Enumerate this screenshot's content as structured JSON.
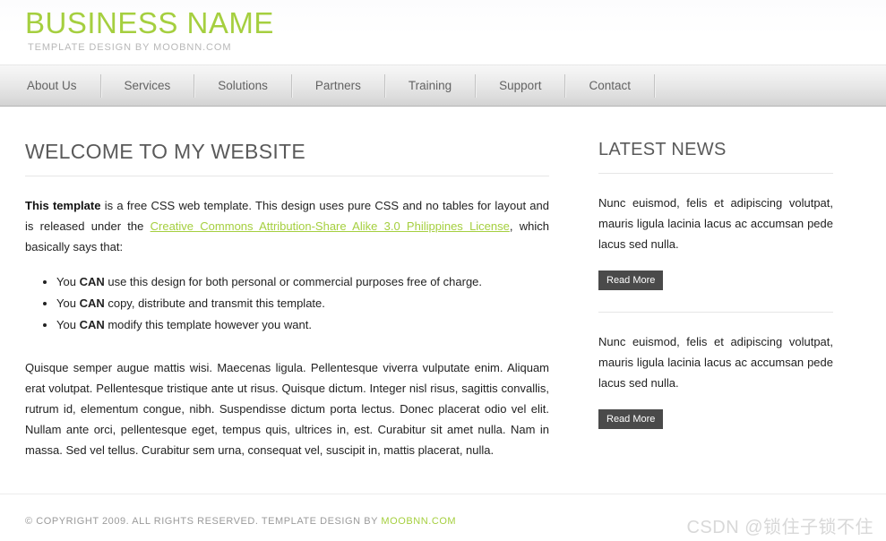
{
  "header": {
    "site_title": "BUSINESS NAME",
    "tagline": "TEMPLATE DESIGN BY MOOBNN.COM",
    "brand_color": "#a5cf3f"
  },
  "nav": {
    "items": [
      {
        "label": "About Us"
      },
      {
        "label": "Services"
      },
      {
        "label": "Solutions"
      },
      {
        "label": "Partners"
      },
      {
        "label": "Training"
      },
      {
        "label": "Support"
      },
      {
        "label": "Contact"
      }
    ]
  },
  "main": {
    "heading": "WELCOME TO MY WEBSITE",
    "intro": {
      "lead": "This template",
      "part1": " is a free CSS web template. This design uses pure CSS and no tables for layout and is released under the ",
      "link_text": "Creative Commons Attribution-Share Alike 3.0 Philippines License",
      "part2": ", which basically says that:"
    },
    "bullets": [
      {
        "pre": "You ",
        "strong": "CAN",
        "post": " use this design for both personal or commercial purposes free of charge."
      },
      {
        "pre": "You ",
        "strong": "CAN",
        "post": " copy, distribute and transmit this template."
      },
      {
        "pre": "You ",
        "strong": "CAN",
        "post": " modify this template however you want."
      }
    ],
    "lorem": "Quisque semper augue mattis wisi. Maecenas ligula. Pellentesque viverra vulputate enim. Aliquam erat volutpat. Pellentesque tristique ante ut risus. Quisque dictum. Integer nisl risus, sagittis convallis, rutrum id, elementum congue, nibh. Suspendisse dictum porta lectus. Donec placerat odio vel elit. Nullam ante orci, pellentesque eget, tempus quis, ultrices in, est. Curabitur sit amet nulla. Nam in massa. Sed vel tellus. Curabitur sem urna, consequat vel, suscipit in, mattis placerat, nulla."
  },
  "sidebar": {
    "heading": "LATEST NEWS",
    "news": [
      {
        "text": "Nunc euismod, felis et adipiscing volutpat, mauris ligula lacinia lacus ac accumsan pede lacus sed nulla.",
        "button_label": "Read More"
      },
      {
        "text": "Nunc euismod, felis et adipiscing volutpat, mauris ligula lacinia lacus ac accumsan pede lacus sed nulla.",
        "button_label": "Read More"
      }
    ]
  },
  "footer": {
    "copyright": "© COPYRIGHT 2009. ALL RIGHTS RESERVED. TEMPLATE DESIGN BY ",
    "credit_link": "MOOBNN.COM",
    "watermark": "CSDN @锁住子锁不住"
  }
}
